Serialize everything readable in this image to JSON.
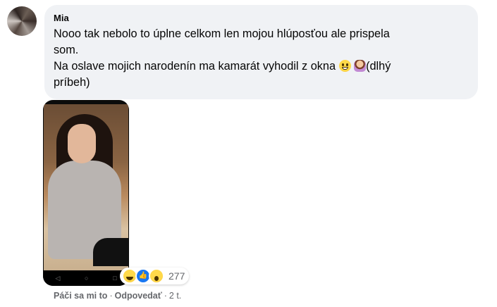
{
  "comment": {
    "author": "Mia",
    "lines": [
      "Nooo tak nebolo to úplne celkom len mojou hlúposťou ale prispela",
      "som.",
      "Na oslave mojich narodenín ma kamarát vyhodil z okna",
      "(dlhý",
      "príbeh)"
    ],
    "emojis": [
      "grinning-face",
      "person-tipping-hand"
    ]
  },
  "photo": {
    "nav_icons": [
      "◁",
      "○",
      "□"
    ]
  },
  "reactions": {
    "icons": [
      "haha-reaction-icon",
      "like-reaction-icon",
      "wow-reaction-icon"
    ],
    "count": "277"
  },
  "actions": {
    "like": "Páči sa mi to",
    "separator": "·",
    "reply": "Odpovedať",
    "time": "2 t."
  }
}
